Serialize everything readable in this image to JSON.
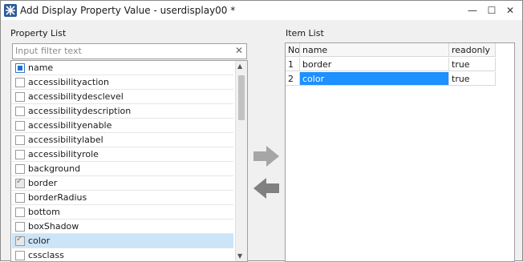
{
  "window": {
    "title": "Add Display Property Value - userdisplay00 *",
    "minimize_glyph": "—",
    "restore_glyph": "☐",
    "close_glyph": "✕"
  },
  "property_list": {
    "label": "Property List",
    "filter_placeholder": "Input filter text",
    "filter_value": "",
    "clear_glyph": "✕",
    "header_label": "name",
    "items": [
      {
        "label": "accessibilityaction",
        "checked": false
      },
      {
        "label": "accessibilitydesclevel",
        "checked": false
      },
      {
        "label": "accessibilitydescription",
        "checked": false
      },
      {
        "label": "accessibilityenable",
        "checked": false
      },
      {
        "label": "accessibilitylabel",
        "checked": false
      },
      {
        "label": "accessibilityrole",
        "checked": false
      },
      {
        "label": "background",
        "checked": false
      },
      {
        "label": "border",
        "checked": true
      },
      {
        "label": "borderRadius",
        "checked": false
      },
      {
        "label": "bottom",
        "checked": false
      },
      {
        "label": "boxShadow",
        "checked": false
      },
      {
        "label": "color",
        "checked": true,
        "selected": true
      },
      {
        "label": "cssclass",
        "checked": false
      }
    ],
    "scroll_up_glyph": "▲",
    "scroll_down_glyph": "▼"
  },
  "item_list": {
    "label": "Item List",
    "columns": [
      "No",
      "name",
      "readonly"
    ],
    "rows": [
      {
        "no": "1",
        "name": "border",
        "readonly": "true"
      },
      {
        "no": "2",
        "name": "color",
        "readonly": "true"
      }
    ]
  },
  "colors": {
    "selected_row": "#cce4f7",
    "selected_cell": "#1e90ff",
    "arrow": "#a6a6a6"
  },
  "icons": [
    "app-icon",
    "minimize-icon",
    "restore-icon",
    "close-icon",
    "clear-filter-icon",
    "move-right-arrow-icon",
    "move-left-arrow-icon"
  ]
}
